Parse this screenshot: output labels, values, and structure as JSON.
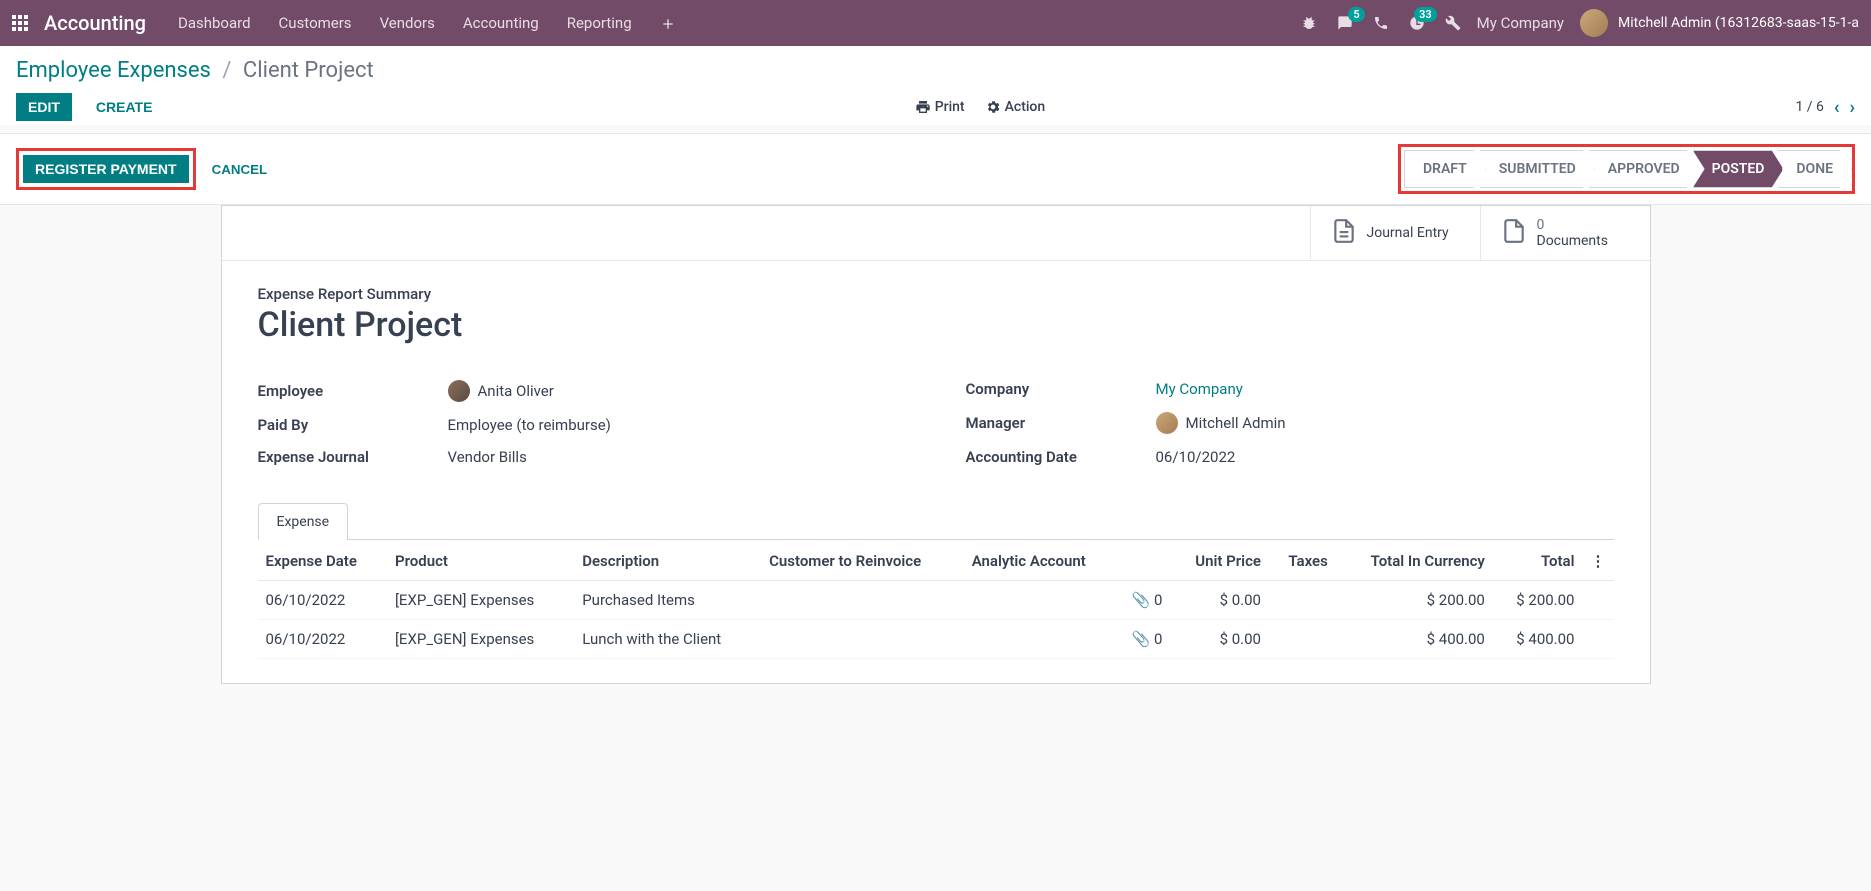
{
  "nav": {
    "brand": "Accounting",
    "menu": [
      "Dashboard",
      "Customers",
      "Vendors",
      "Accounting",
      "Reporting"
    ],
    "msg_badge": "5",
    "activity_badge": "33",
    "company": "My Company",
    "user": "Mitchell Admin (16312683-saas-15-1-a"
  },
  "breadcrumb": {
    "parent": "Employee Expenses",
    "current": "Client Project"
  },
  "cp": {
    "edit": "Edit",
    "create": "Create",
    "print": "Print",
    "action": "Action",
    "pager": "1 / 6"
  },
  "statusbar": {
    "register": "Register Payment",
    "cancel": "Cancel",
    "steps": [
      "DRAFT",
      "SUBMITTED",
      "APPROVED",
      "POSTED",
      "DONE"
    ],
    "active_index": 3
  },
  "button_box": {
    "journal": "Journal Entry",
    "docs_count": "0",
    "docs_label": "Documents"
  },
  "form": {
    "title_label": "Expense Report Summary",
    "title": "Client Project",
    "left": {
      "employee_lbl": "Employee",
      "employee_val": "Anita Oliver",
      "paidby_lbl": "Paid By",
      "paidby_val": "Employee (to reimburse)",
      "journal_lbl": "Expense Journal",
      "journal_val": "Vendor Bills"
    },
    "right": {
      "company_lbl": "Company",
      "company_val": "My Company",
      "manager_lbl": "Manager",
      "manager_val": "Mitchell Admin",
      "accdate_lbl": "Accounting Date",
      "accdate_val": "06/10/2022"
    }
  },
  "tab": {
    "label": "Expense"
  },
  "table": {
    "cols": {
      "date": "Expense Date",
      "product": "Product",
      "desc": "Description",
      "cust": "Customer to Reinvoice",
      "analytic": "Analytic Account",
      "uprice": "Unit Price",
      "taxes": "Taxes",
      "curr": "Total In Currency",
      "total": "Total"
    },
    "rows": [
      {
        "date": "06/10/2022",
        "product": "[EXP_GEN] Expenses",
        "desc": "Purchased Items",
        "attach": "0",
        "uprice": "$ 0.00",
        "curr": "$ 200.00",
        "total": "$ 200.00"
      },
      {
        "date": "06/10/2022",
        "product": "[EXP_GEN] Expenses",
        "desc": "Lunch with the Client",
        "attach": "0",
        "uprice": "$ 0.00",
        "curr": "$ 400.00",
        "total": "$ 400.00"
      }
    ]
  }
}
